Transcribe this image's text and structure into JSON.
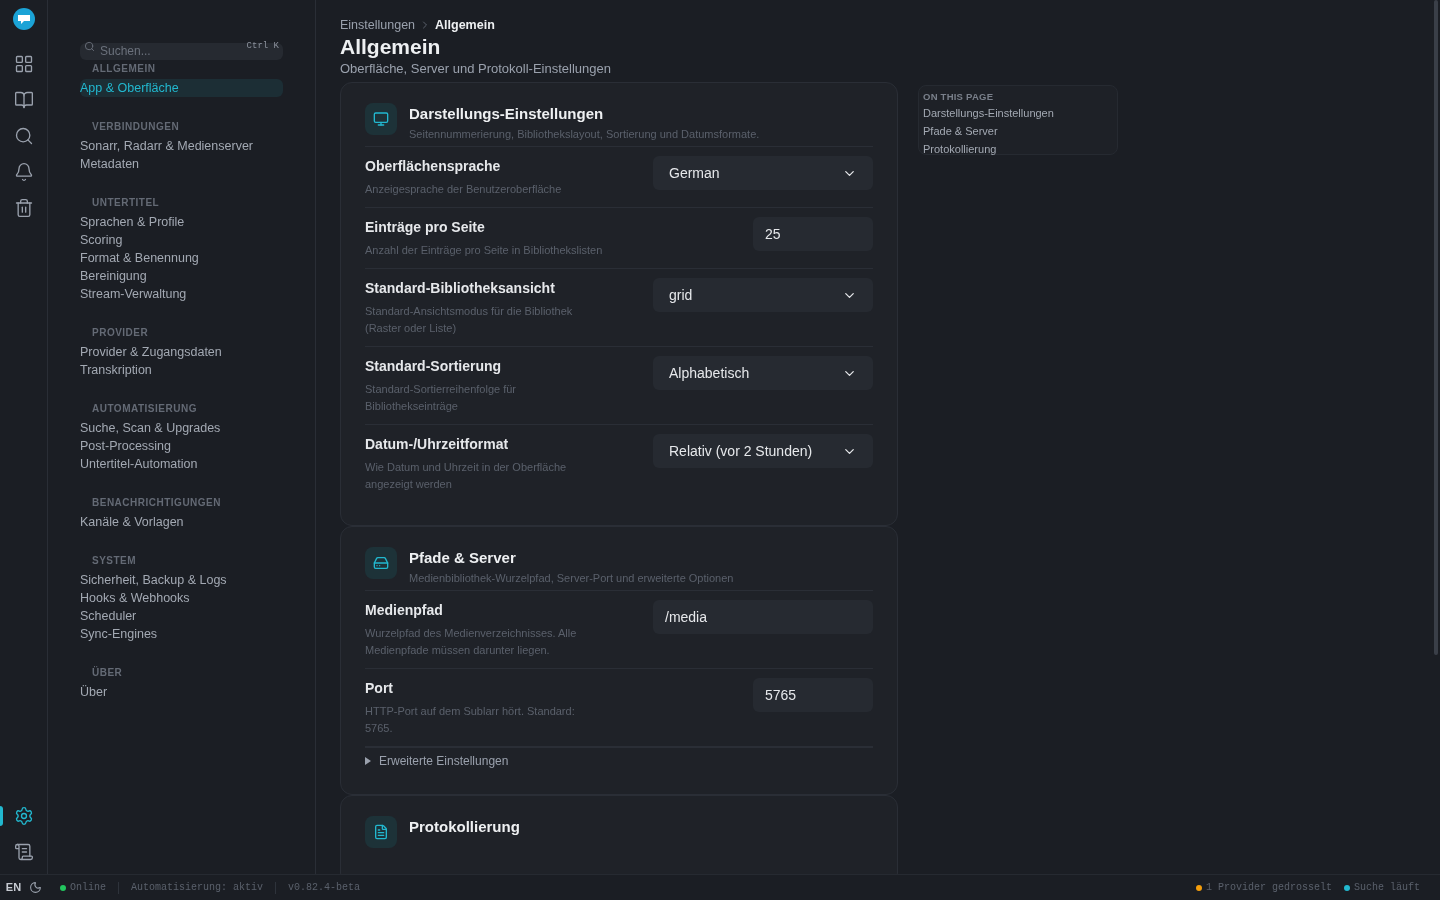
{
  "rail": {
    "top": [
      {
        "kind": "logo",
        "selected": false
      },
      {
        "kind": "dashboard",
        "selected": false
      },
      {
        "kind": "library",
        "selected": false
      },
      {
        "kind": "search",
        "selected": false
      },
      {
        "kind": "bell",
        "selected": false
      },
      {
        "kind": "trash",
        "selected": false
      }
    ],
    "bottom": [
      {
        "kind": "settings",
        "selected": true
      },
      {
        "kind": "logs",
        "selected": false
      }
    ],
    "language": "EN"
  },
  "sidebar": {
    "search": {
      "placeholder": "Suchen...",
      "shortcut": "Ctrl K"
    },
    "groups": [
      {
        "title": "ALLGEMEIN",
        "items": [
          {
            "label": "App & Oberfläche",
            "selected": true
          }
        ]
      },
      {
        "title": "VERBINDUNGEN",
        "items": [
          {
            "label": "Sonarr, Radarr & Medienserver",
            "selected": false
          },
          {
            "label": "Metadaten",
            "selected": false
          }
        ]
      },
      {
        "title": "UNTERTITEL",
        "items": [
          {
            "label": "Sprachen & Profile",
            "selected": false
          },
          {
            "label": "Scoring",
            "selected": false
          },
          {
            "label": "Format & Benennung",
            "selected": false
          },
          {
            "label": "Bereinigung",
            "selected": false
          },
          {
            "label": "Stream-Verwaltung",
            "selected": false
          }
        ]
      },
      {
        "title": "PROVIDER",
        "items": [
          {
            "label": "Provider & Zugangsdaten",
            "selected": false
          },
          {
            "label": "Transkription",
            "selected": false
          }
        ]
      },
      {
        "title": "AUTOMATISIERUNG",
        "items": [
          {
            "label": "Suche, Scan & Upgrades",
            "selected": false
          },
          {
            "label": "Post-Processing",
            "selected": false
          },
          {
            "label": "Untertitel-Automation",
            "selected": false
          }
        ]
      },
      {
        "title": "BENACHRICHTIGUNGEN",
        "items": [
          {
            "label": "Kanäle & Vorlagen",
            "selected": false
          }
        ]
      },
      {
        "title": "SYSTEM",
        "items": [
          {
            "label": "Sicherheit, Backup & Logs",
            "selected": false
          },
          {
            "label": "Hooks & Webhooks",
            "selected": false
          },
          {
            "label": "Scheduler",
            "selected": false
          },
          {
            "label": "Sync-Engines",
            "selected": false
          }
        ]
      },
      {
        "title": "ÜBER",
        "items": [
          {
            "label": "Über",
            "selected": false
          }
        ]
      }
    ]
  },
  "breadcrumb": [
    {
      "label": "Einstellungen",
      "selected": false
    },
    {
      "label": "Allgemein",
      "selected": true
    }
  ],
  "page": {
    "title": "Allgemein",
    "subtitle": "Oberfläche, Server und Protokoll-Einstellungen"
  },
  "sections": [
    {
      "kind": "monitor",
      "title": "Darstellungs-Einstellungen",
      "subtitle": "Seitennummerierung, Bibliothekslayout, Sortierung und Datumsformate.",
      "rows": [
        {
          "kind": "select",
          "label": "Oberflächensprache",
          "hint": "Anzeigesprache der Benutzeroberfläche",
          "value": "German"
        },
        {
          "kind": "number",
          "label": "Einträge pro Seite",
          "hint": "Anzahl der Einträge pro Seite in Bibliothekslisten",
          "value": "25"
        },
        {
          "kind": "select",
          "label": "Standard-Bibliotheksansicht",
          "hint": "Standard-Ansichtsmodus für die Bibliothek (Raster oder Liste)",
          "value": "grid"
        },
        {
          "kind": "select",
          "label": "Standard-Sortierung",
          "hint": "Standard-Sortierreihenfolge für Bibliothekseinträge",
          "value": "Alphabetisch"
        },
        {
          "kind": "select",
          "label": "Datum-/Uhrzeitformat",
          "hint": "Wie Datum und Uhrzeit in der Oberfläche angezeigt werden",
          "value": "Relativ (vor 2 Stunden)"
        }
      ]
    },
    {
      "kind": "drive",
      "title": "Pfade & Server",
      "subtitle": "Medienbibliothek-Wurzelpfad, Server-Port und erweiterte Optionen",
      "rows": [
        {
          "kind": "text",
          "label": "Medienpfad",
          "hint": "Wurzelpfad des Medienverzeichnisses. Alle Medienpfade müssen darunter liegen.",
          "value": "/media"
        },
        {
          "kind": "number",
          "label": "Port",
          "hint": "HTTP-Port auf dem Sublarr hört. Standard: 5765.",
          "value": "5765"
        }
      ],
      "advanced": {
        "label": "Erweiterte Einstellungen",
        "expanded": false
      }
    },
    {
      "kind": "file",
      "title": "Protokollierung"
    }
  ],
  "toc": {
    "title": "ON THIS PAGE",
    "items": [
      {
        "label": "Darstellungs-Einstellungen"
      },
      {
        "label": "Pfade & Server"
      },
      {
        "label": "Protokollierung"
      }
    ]
  },
  "status_bar": {
    "left": [
      {
        "text": "Online",
        "color": "#22c55e"
      },
      {
        "text": "Automatisierung: aktiv"
      },
      {
        "text": "v0.82.4-beta"
      }
    ],
    "right": [
      {
        "text": "1 Provider gedrosselt",
        "color": "#f59e0b"
      },
      {
        "text": "Suche läuft",
        "color": "#22b8cf"
      }
    ]
  }
}
